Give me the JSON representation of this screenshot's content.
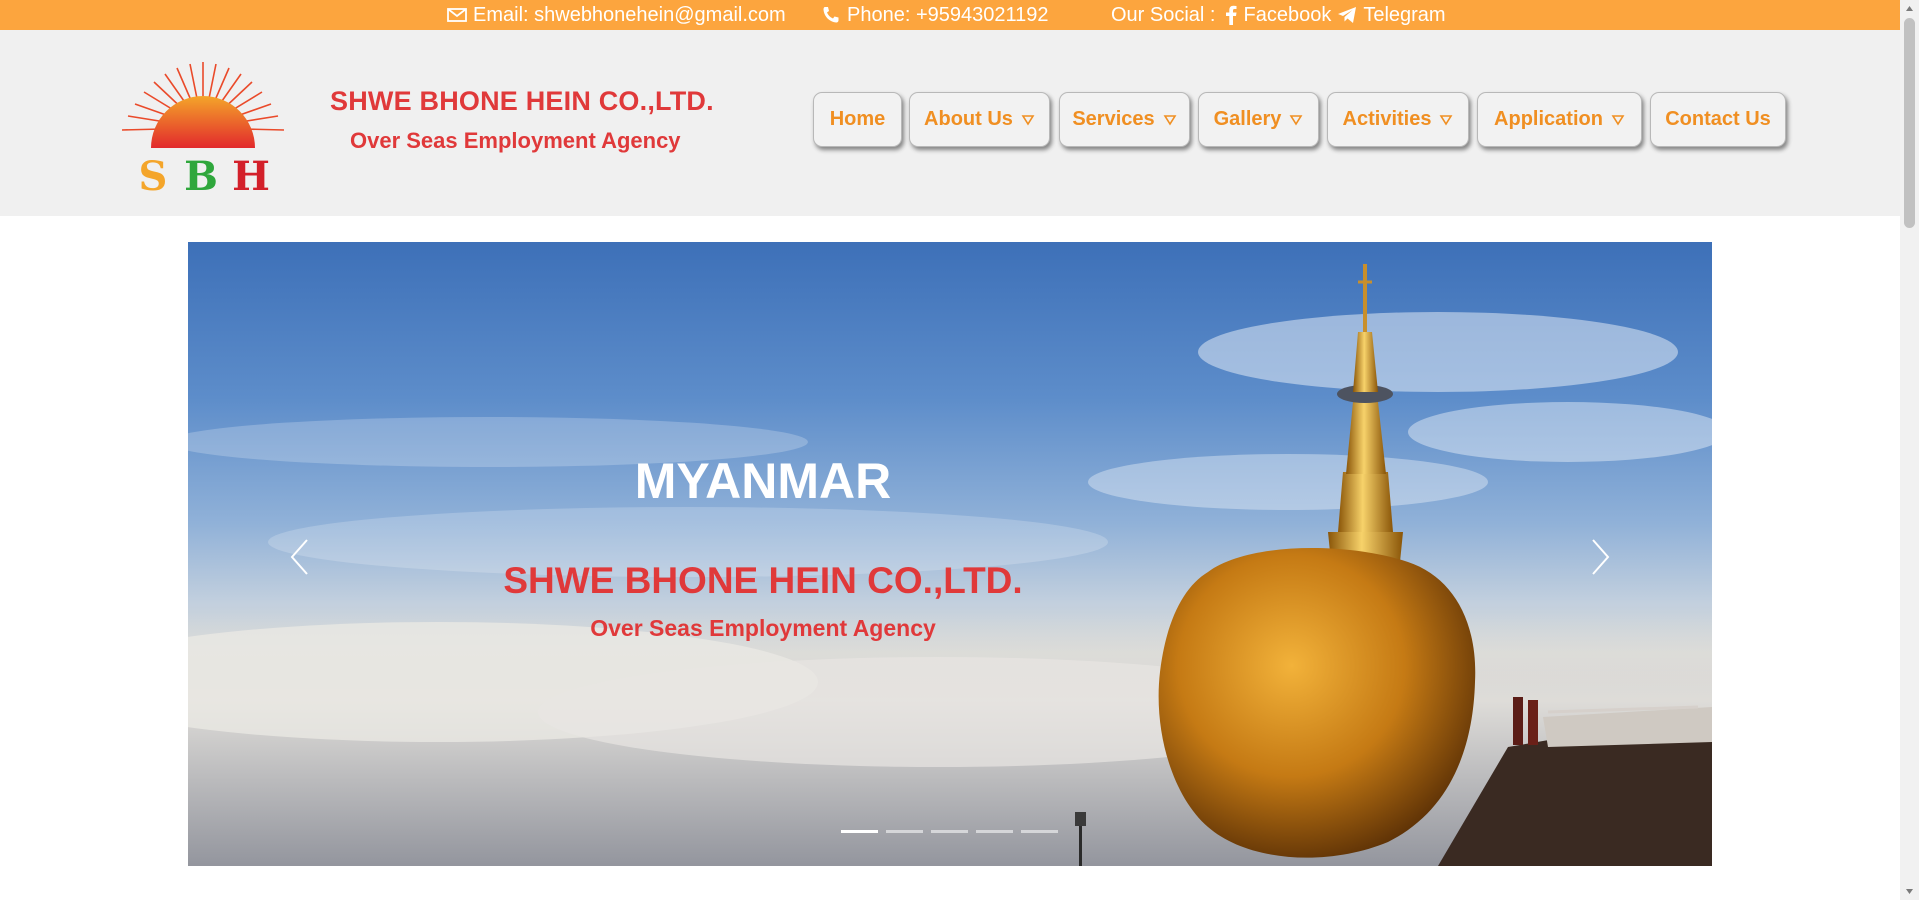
{
  "topbar": {
    "email": "Email: shwebhonehein@gmail.com",
    "phone": "Phone: +95943021192",
    "social_label": "Our Social :",
    "facebook": "Facebook",
    "telegram": "Telegram",
    "background": "#fca53e"
  },
  "header": {
    "logo_letters": [
      "S",
      "B",
      "H"
    ],
    "company_name": "SHWE BHONE HEIN CO.,LTD.",
    "tagline": "Over Seas Employment Agency"
  },
  "nav": {
    "items": [
      {
        "label": "Home",
        "has_dropdown": false
      },
      {
        "label": "About Us",
        "has_dropdown": true
      },
      {
        "label": "Services",
        "has_dropdown": true
      },
      {
        "label": "Gallery",
        "has_dropdown": true
      },
      {
        "label": "Activities",
        "has_dropdown": true
      },
      {
        "label": "Application",
        "has_dropdown": true
      },
      {
        "label": "Contact Us",
        "has_dropdown": false
      }
    ],
    "text_color": "#f08f22"
  },
  "hero": {
    "heading": "MYANMAR",
    "title": "SHWE BHONE HEIN CO.,LTD.",
    "subtitle": "Over Seas Employment Agency",
    "slide_count": 5,
    "active_slide": 1,
    "accent": "#e0393a"
  }
}
